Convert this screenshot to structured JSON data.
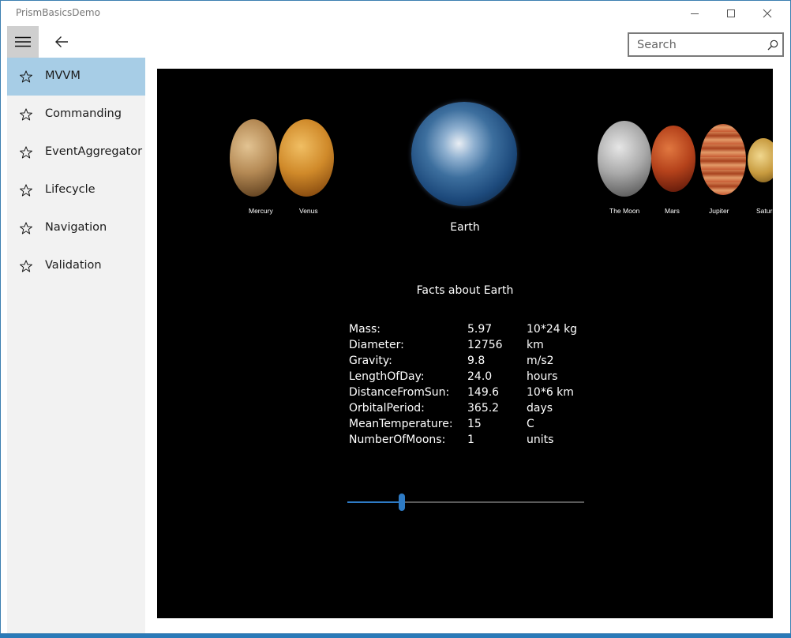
{
  "app": {
    "title": "PrismBasicsDemo"
  },
  "search": {
    "placeholder": "Search"
  },
  "nav": {
    "items": [
      {
        "label": "MVVM",
        "selected": true
      },
      {
        "label": "Commanding"
      },
      {
        "label": "EventAggregator"
      },
      {
        "label": "Lifecycle"
      },
      {
        "label": "Navigation"
      },
      {
        "label": "Validation"
      }
    ]
  },
  "planets": {
    "labels": [
      "Mercury",
      "Venus",
      "The Moon",
      "Mars",
      "Jupiter",
      "Saturn"
    ],
    "selected": "Earth"
  },
  "facts": {
    "title": "Facts about Earth",
    "rows": [
      {
        "name": "Mass:",
        "value": "5.97",
        "unit": "10*24 kg"
      },
      {
        "name": "Diameter:",
        "value": "12756",
        "unit": "km"
      },
      {
        "name": "Gravity:",
        "value": "9.8",
        "unit": "m/s2"
      },
      {
        "name": "LengthOfDay:",
        "value": "24.0",
        "unit": "hours"
      },
      {
        "name": "DistanceFromSun:",
        "value": "149.6",
        "unit": "10*6 km"
      },
      {
        "name": "OrbitalPeriod:",
        "value": "365.2",
        "unit": "days"
      },
      {
        "name": "MeanTemperature:",
        "value": "15",
        "unit": "C"
      },
      {
        "name": "NumberOfMoons:",
        "value": "1",
        "unit": "units"
      }
    ]
  },
  "slider": {
    "value": 0.23
  },
  "colors": {
    "accent": "#2e7bc5",
    "selected_nav": "#a7cde6",
    "sidebar_bg": "#f2f2f2",
    "content_bg": "#000000"
  }
}
